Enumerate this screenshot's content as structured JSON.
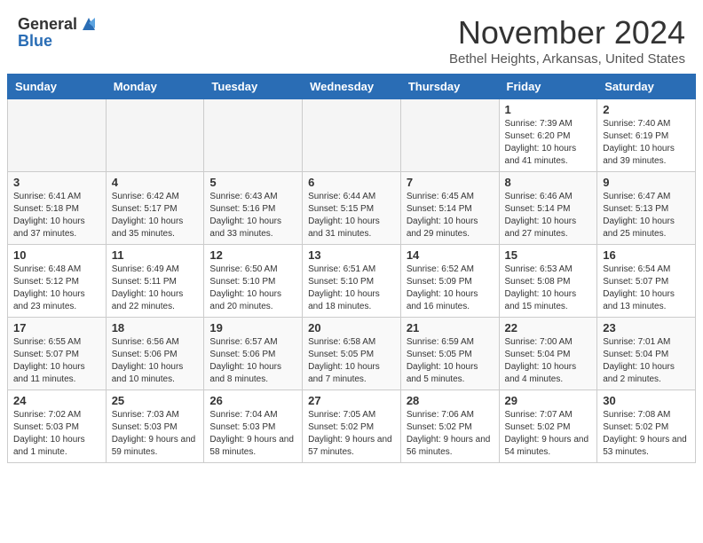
{
  "header": {
    "logo_line1": "General",
    "logo_line2": "Blue",
    "month": "November 2024",
    "location": "Bethel Heights, Arkansas, United States"
  },
  "days_of_week": [
    "Sunday",
    "Monday",
    "Tuesday",
    "Wednesday",
    "Thursday",
    "Friday",
    "Saturday"
  ],
  "weeks": [
    [
      {
        "day": "",
        "empty": true
      },
      {
        "day": "",
        "empty": true
      },
      {
        "day": "",
        "empty": true
      },
      {
        "day": "",
        "empty": true
      },
      {
        "day": "",
        "empty": true
      },
      {
        "day": "1",
        "sunrise": "Sunrise: 7:39 AM",
        "sunset": "Sunset: 6:20 PM",
        "daylight": "Daylight: 10 hours and 41 minutes."
      },
      {
        "day": "2",
        "sunrise": "Sunrise: 7:40 AM",
        "sunset": "Sunset: 6:19 PM",
        "daylight": "Daylight: 10 hours and 39 minutes."
      }
    ],
    [
      {
        "day": "3",
        "sunrise": "Sunrise: 6:41 AM",
        "sunset": "Sunset: 5:18 PM",
        "daylight": "Daylight: 10 hours and 37 minutes."
      },
      {
        "day": "4",
        "sunrise": "Sunrise: 6:42 AM",
        "sunset": "Sunset: 5:17 PM",
        "daylight": "Daylight: 10 hours and 35 minutes."
      },
      {
        "day": "5",
        "sunrise": "Sunrise: 6:43 AM",
        "sunset": "Sunset: 5:16 PM",
        "daylight": "Daylight: 10 hours and 33 minutes."
      },
      {
        "day": "6",
        "sunrise": "Sunrise: 6:44 AM",
        "sunset": "Sunset: 5:15 PM",
        "daylight": "Daylight: 10 hours and 31 minutes."
      },
      {
        "day": "7",
        "sunrise": "Sunrise: 6:45 AM",
        "sunset": "Sunset: 5:14 PM",
        "daylight": "Daylight: 10 hours and 29 minutes."
      },
      {
        "day": "8",
        "sunrise": "Sunrise: 6:46 AM",
        "sunset": "Sunset: 5:14 PM",
        "daylight": "Daylight: 10 hours and 27 minutes."
      },
      {
        "day": "9",
        "sunrise": "Sunrise: 6:47 AM",
        "sunset": "Sunset: 5:13 PM",
        "daylight": "Daylight: 10 hours and 25 minutes."
      }
    ],
    [
      {
        "day": "10",
        "sunrise": "Sunrise: 6:48 AM",
        "sunset": "Sunset: 5:12 PM",
        "daylight": "Daylight: 10 hours and 23 minutes."
      },
      {
        "day": "11",
        "sunrise": "Sunrise: 6:49 AM",
        "sunset": "Sunset: 5:11 PM",
        "daylight": "Daylight: 10 hours and 22 minutes."
      },
      {
        "day": "12",
        "sunrise": "Sunrise: 6:50 AM",
        "sunset": "Sunset: 5:10 PM",
        "daylight": "Daylight: 10 hours and 20 minutes."
      },
      {
        "day": "13",
        "sunrise": "Sunrise: 6:51 AM",
        "sunset": "Sunset: 5:10 PM",
        "daylight": "Daylight: 10 hours and 18 minutes."
      },
      {
        "day": "14",
        "sunrise": "Sunrise: 6:52 AM",
        "sunset": "Sunset: 5:09 PM",
        "daylight": "Daylight: 10 hours and 16 minutes."
      },
      {
        "day": "15",
        "sunrise": "Sunrise: 6:53 AM",
        "sunset": "Sunset: 5:08 PM",
        "daylight": "Daylight: 10 hours and 15 minutes."
      },
      {
        "day": "16",
        "sunrise": "Sunrise: 6:54 AM",
        "sunset": "Sunset: 5:07 PM",
        "daylight": "Daylight: 10 hours and 13 minutes."
      }
    ],
    [
      {
        "day": "17",
        "sunrise": "Sunrise: 6:55 AM",
        "sunset": "Sunset: 5:07 PM",
        "daylight": "Daylight: 10 hours and 11 minutes."
      },
      {
        "day": "18",
        "sunrise": "Sunrise: 6:56 AM",
        "sunset": "Sunset: 5:06 PM",
        "daylight": "Daylight: 10 hours and 10 minutes."
      },
      {
        "day": "19",
        "sunrise": "Sunrise: 6:57 AM",
        "sunset": "Sunset: 5:06 PM",
        "daylight": "Daylight: 10 hours and 8 minutes."
      },
      {
        "day": "20",
        "sunrise": "Sunrise: 6:58 AM",
        "sunset": "Sunset: 5:05 PM",
        "daylight": "Daylight: 10 hours and 7 minutes."
      },
      {
        "day": "21",
        "sunrise": "Sunrise: 6:59 AM",
        "sunset": "Sunset: 5:05 PM",
        "daylight": "Daylight: 10 hours and 5 minutes."
      },
      {
        "day": "22",
        "sunrise": "Sunrise: 7:00 AM",
        "sunset": "Sunset: 5:04 PM",
        "daylight": "Daylight: 10 hours and 4 minutes."
      },
      {
        "day": "23",
        "sunrise": "Sunrise: 7:01 AM",
        "sunset": "Sunset: 5:04 PM",
        "daylight": "Daylight: 10 hours and 2 minutes."
      }
    ],
    [
      {
        "day": "24",
        "sunrise": "Sunrise: 7:02 AM",
        "sunset": "Sunset: 5:03 PM",
        "daylight": "Daylight: 10 hours and 1 minute."
      },
      {
        "day": "25",
        "sunrise": "Sunrise: 7:03 AM",
        "sunset": "Sunset: 5:03 PM",
        "daylight": "Daylight: 9 hours and 59 minutes."
      },
      {
        "day": "26",
        "sunrise": "Sunrise: 7:04 AM",
        "sunset": "Sunset: 5:03 PM",
        "daylight": "Daylight: 9 hours and 58 minutes."
      },
      {
        "day": "27",
        "sunrise": "Sunrise: 7:05 AM",
        "sunset": "Sunset: 5:02 PM",
        "daylight": "Daylight: 9 hours and 57 minutes."
      },
      {
        "day": "28",
        "sunrise": "Sunrise: 7:06 AM",
        "sunset": "Sunset: 5:02 PM",
        "daylight": "Daylight: 9 hours and 56 minutes."
      },
      {
        "day": "29",
        "sunrise": "Sunrise: 7:07 AM",
        "sunset": "Sunset: 5:02 PM",
        "daylight": "Daylight: 9 hours and 54 minutes."
      },
      {
        "day": "30",
        "sunrise": "Sunrise: 7:08 AM",
        "sunset": "Sunset: 5:02 PM",
        "daylight": "Daylight: 9 hours and 53 minutes."
      }
    ]
  ]
}
